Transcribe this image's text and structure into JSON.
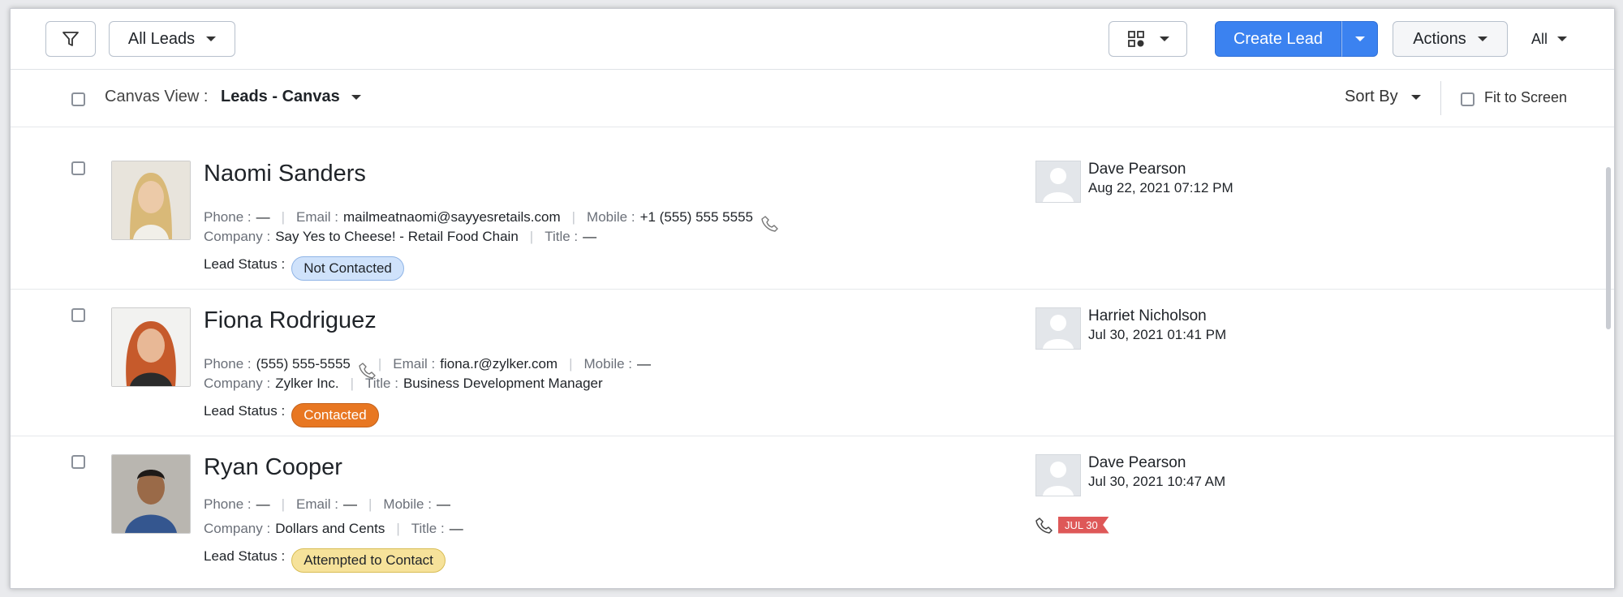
{
  "toolbar": {
    "view_selector_label": "All Leads",
    "create_label": "Create Lead",
    "actions_label": "Actions",
    "all_label": "All"
  },
  "viewbar": {
    "canvas_view_label": "Canvas View :",
    "canvas_view_value": "Leads - Canvas",
    "sort_by_label": "Sort By",
    "fit_to_screen_label": "Fit to Screen"
  },
  "labels": {
    "phone": "Phone :",
    "email": "Email :",
    "mobile": "Mobile :",
    "company": "Company :",
    "title": "Title :",
    "lead_status": "Lead Status :"
  },
  "colors": {
    "primary": "#3b82f0",
    "status_not_contacted_bg": "#cfe2fb",
    "status_contacted_bg": "#e87722",
    "status_attempted_bg": "#f6e29a",
    "flag": "#de5858"
  },
  "leads": [
    {
      "name": "Naomi Sanders",
      "phone": "—",
      "email": "mailmeatnaomi@sayyesretails.com",
      "mobile": "+1 (555) 555 5555",
      "company": "Say Yes to Cheese! - Retail Food Chain",
      "title": "—",
      "status": "Not Contacted",
      "owner": "Dave Pearson",
      "date": "Aug 22, 2021 07:12 PM"
    },
    {
      "name": "Fiona Rodriguez",
      "phone": "(555) 555-5555",
      "email": "fiona.r@zylker.com",
      "mobile": "—",
      "company": "Zylker Inc.",
      "title": "Business Development Manager",
      "status": "Contacted",
      "owner": "Harriet Nicholson",
      "date": "Jul 30, 2021 01:41 PM"
    },
    {
      "name": "Ryan Cooper",
      "phone": "—",
      "email": "—",
      "mobile": "—",
      "company": "Dollars and Cents",
      "title": "—",
      "status": "Attempted to Contact",
      "owner": "Dave Pearson",
      "date": "Jul 30, 2021 10:47 AM",
      "call_tag": "JUL 30"
    }
  ]
}
